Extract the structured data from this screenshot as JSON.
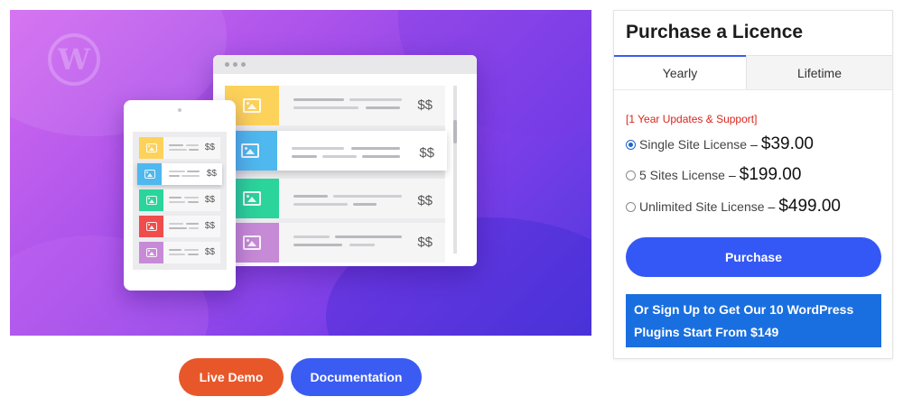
{
  "hero": {
    "desktop_prices": [
      "$$",
      "$$",
      "$$",
      "$$"
    ],
    "tablet_prices": [
      "$$",
      "$$",
      "$$",
      "$$",
      "$$"
    ],
    "thumb_colors": [
      "#fdd25a",
      "#4fb8ee",
      "#2bd49a",
      "#ef4c4c",
      "#c78ad6"
    ]
  },
  "buttons": {
    "live_demo": "Live Demo",
    "documentation": "Documentation"
  },
  "panel": {
    "title": "Purchase a Licence",
    "tabs": [
      {
        "label": "Yearly",
        "active": true
      },
      {
        "label": "Lifetime",
        "active": false
      }
    ],
    "note": "[1 Year Updates & Support]",
    "options": [
      {
        "label": "Single Site License",
        "dash": "–",
        "price": "$39.00",
        "checked": true
      },
      {
        "label": "5 Sites License",
        "dash": "–",
        "price": "$199.00",
        "checked": false
      },
      {
        "label": "Unlimited Site License",
        "dash": "–",
        "price": "$499.00",
        "checked": false
      }
    ],
    "purchase_label": "Purchase",
    "signup_line1": "Or Sign Up to Get Our 10 WordPress",
    "signup_line2": "Plugins Start From $149"
  },
  "colors": {
    "accent_blue": "#3458f5",
    "demo_orange": "#e8572a",
    "note_red": "#d8261c"
  }
}
